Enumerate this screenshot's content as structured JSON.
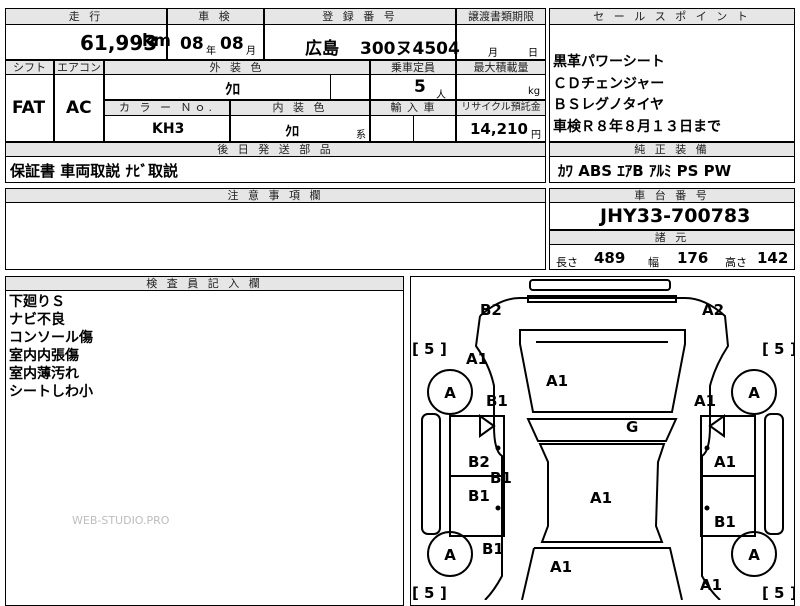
{
  "top": {
    "mileage_label": "走 行",
    "mileage_value": "61,993",
    "mileage_unit": "km",
    "inspection_label": "車 検",
    "inspection_year": "08",
    "inspection_year_unit": "年",
    "inspection_month": "08",
    "inspection_month_unit": "月",
    "registration_label": "登 録 番 号",
    "registration_place": "広島",
    "registration_number": "300ヌ4504",
    "transfer_label": "譲渡書類期限",
    "transfer_month_unit": "月",
    "transfer_day_unit": "日"
  },
  "sales_points": {
    "title": "セ ー ル ス ポ イ ン ト",
    "items": [
      "黒革パワーシート",
      "ＣＤチェンジャー",
      "ＢＳレグノタイヤ",
      "車検Ｒ８年８月１３日まで"
    ]
  },
  "row2": {
    "shift_label": "シフト",
    "shift_value": "FAT",
    "ac_label": "エアコン",
    "ac_value": "AC",
    "exterior_label": "外 装 色",
    "exterior_value": "ｸﾛ",
    "capacity_label": "乗車定員",
    "capacity_value": "5",
    "capacity_unit": "人",
    "maxload_label": "最大積載量",
    "maxload_unit": "kg",
    "colorno_label": "カ ラ ー Ｎｏ.",
    "colorno_value": "KH3",
    "interior_label": "内 装 色",
    "interior_value": "ｸﾛ",
    "interior_unit": "系",
    "import_label": "輸 入 車",
    "recycle_label": "リサイクル預託金",
    "recycle_value": "14,210",
    "recycle_unit": "円"
  },
  "shipping": {
    "title": "後 日 発 送 部 品",
    "value": "保証書 車両取説 ﾅﾋﾞ取説"
  },
  "equipment": {
    "title": "純 正 装 備",
    "value": "ｶﾜ ABS ｴｱB ｱﾙﾐ PS PW"
  },
  "notes": {
    "title": "注 意 事 項 欄"
  },
  "chassis": {
    "title": "車 台 番 号",
    "value": "JHY33-700783"
  },
  "dims": {
    "title": "諸 元",
    "length_label": "長さ",
    "length_value": "489",
    "width_label": "幅",
    "width_value": "176",
    "height_label": "高さ",
    "height_value": "142"
  },
  "inspector": {
    "title": "検 査 員 記 入 欄",
    "lines": [
      "下廻りＳ",
      "ナビ不良",
      "コンソール傷",
      "室内内張傷",
      "室内薄汚れ",
      "シートしわ小"
    ],
    "watermark": "WEB-STUDIO.PRO"
  },
  "diagram": {
    "marks": {
      "front_bumper_left": "B2",
      "front_bumper_right": "A2",
      "front_fender_left": "A1",
      "front_door_left": "B1",
      "hood": "A1",
      "front_fender_right": "A1",
      "roof": "G",
      "door_fl": "B2",
      "door_fl2": "B1",
      "door_rl": "B1",
      "roof_rear": "A1",
      "door_fr": "A1",
      "door_rr": "B1",
      "rear_door_left": "B1",
      "trunk": "A1",
      "rear_fender_right": "A1"
    },
    "tires": [
      "A",
      "A",
      "A",
      "A"
    ],
    "tread_values": [
      "5",
      "5",
      "5",
      "5"
    ]
  }
}
